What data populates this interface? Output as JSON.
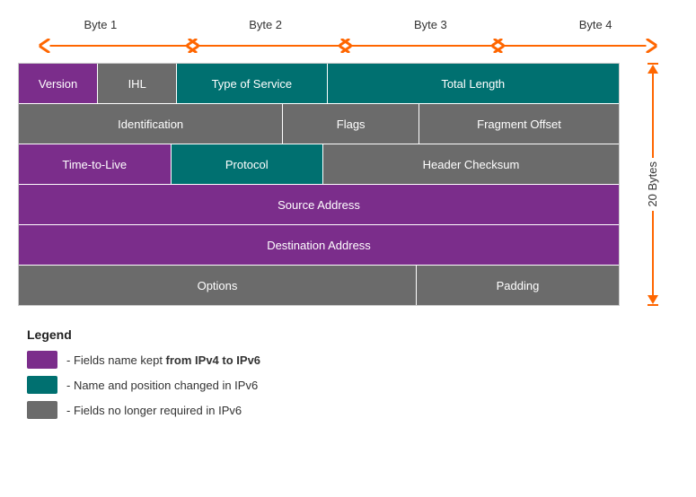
{
  "byteLabels": [
    "Byte 1",
    "Byte 2",
    "Byte 3",
    "Byte 4"
  ],
  "rows": [
    {
      "cells": [
        {
          "label": "Version",
          "color": "purple",
          "flex": 1
        },
        {
          "label": "IHL",
          "color": "gray",
          "flex": 1
        },
        {
          "label": "Type of Service",
          "color": "teal",
          "flex": 2
        },
        {
          "label": "Total Length",
          "color": "teal",
          "flex": 4
        }
      ]
    },
    {
      "cells": [
        {
          "label": "Identification",
          "color": "gray",
          "flex": 4
        },
        {
          "label": "Flags",
          "color": "gray",
          "flex": 2
        },
        {
          "label": "Fragment Offset",
          "color": "gray",
          "flex": 3
        }
      ]
    },
    {
      "cells": [
        {
          "label": "Time-to-Live",
          "color": "purple",
          "flex": 2
        },
        {
          "label": "Protocol",
          "color": "teal",
          "flex": 2
        },
        {
          "label": "Header Checksum",
          "color": "gray",
          "flex": 4
        }
      ]
    },
    {
      "cells": [
        {
          "label": "Source Address",
          "color": "purple",
          "flex": 8
        }
      ]
    },
    {
      "cells": [
        {
          "label": "Destination Address",
          "color": "purple",
          "flex": 8
        }
      ]
    },
    {
      "cells": [
        {
          "label": "Options",
          "color": "gray",
          "flex": 6
        },
        {
          "label": "Padding",
          "color": "gray",
          "flex": 3
        }
      ]
    }
  ],
  "sideLabel": "20 Bytes",
  "legend": {
    "title": "Legend",
    "items": [
      {
        "color": "#7b2d8b",
        "text": "- Fields name kept ",
        "highlight": "from IPv4 to IPv6"
      },
      {
        "color": "#007070",
        "text": "- Name and position changed in IPv6"
      },
      {
        "color": "#6b6b6b",
        "text": "- Fields no longer required in IPv6"
      }
    ]
  }
}
